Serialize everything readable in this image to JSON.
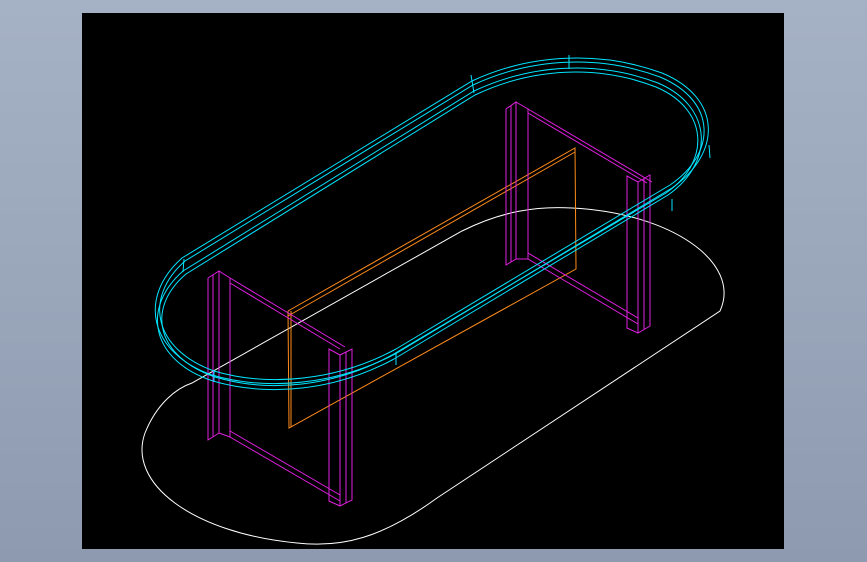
{
  "viewport": {
    "background": "#000000"
  },
  "layer_colors": {
    "tabletop": "#00e5ff",
    "legs": "#e020e0",
    "crossbar": "#ff8c1a",
    "footprint": "#ffffff"
  }
}
